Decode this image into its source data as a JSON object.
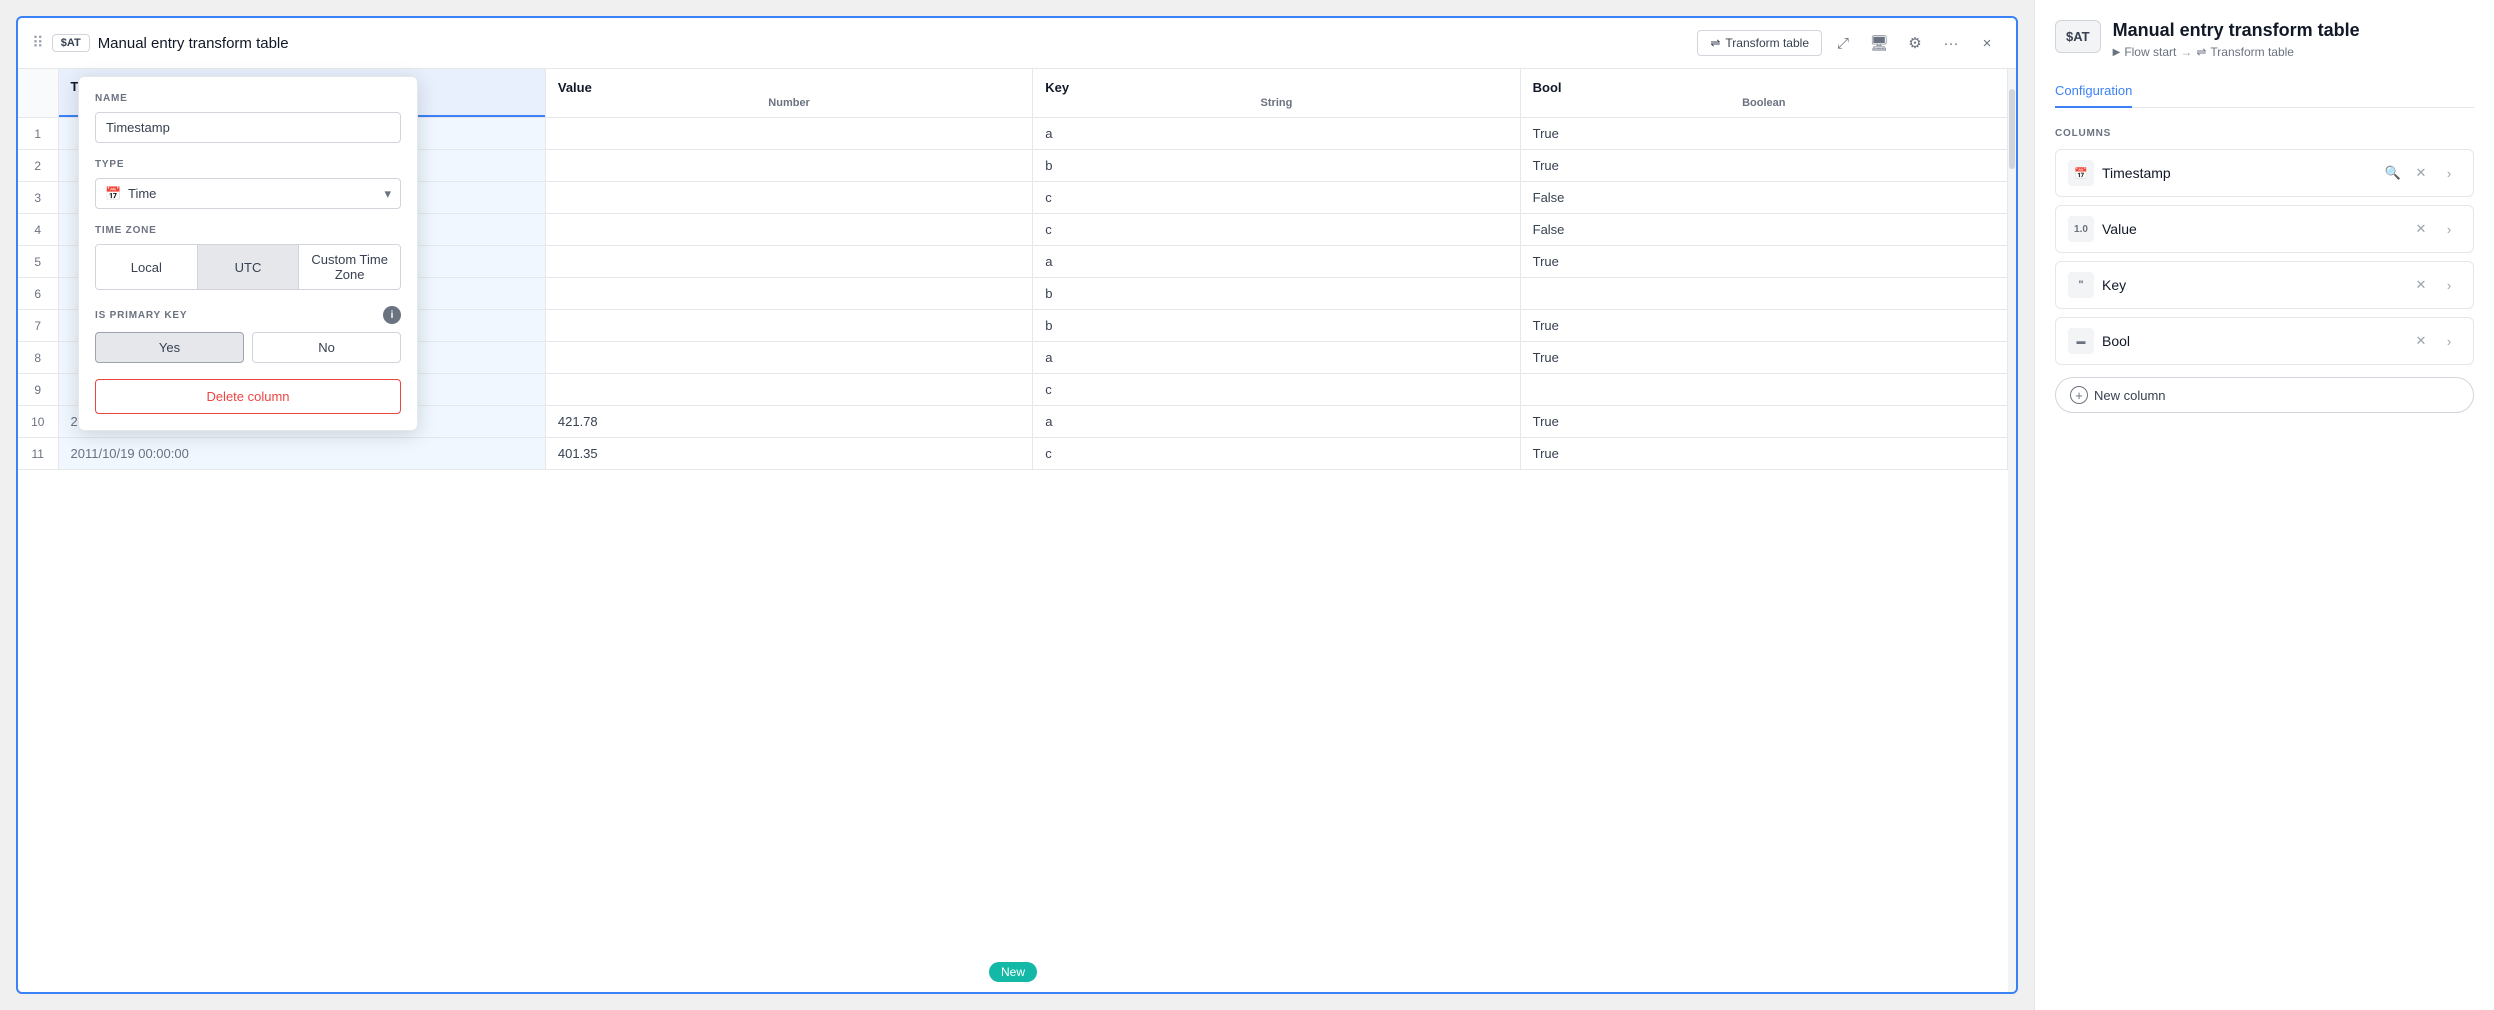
{
  "window": {
    "title": "Manual entry transform table",
    "sat_badge": "$AT",
    "transform_table_btn": "Transform table",
    "close_label": "×"
  },
  "table": {
    "columns": [
      {
        "name": "Timestamp",
        "type": "Time (UTC)",
        "active": true
      },
      {
        "name": "Value",
        "type": "Number",
        "active": false
      },
      {
        "name": "Key",
        "type": "String",
        "active": false
      },
      {
        "name": "Bool",
        "type": "Boolean",
        "active": false
      }
    ],
    "rows": [
      {
        "num": 1,
        "timestamp": "",
        "value": "",
        "key": "a",
        "bool": "True"
      },
      {
        "num": 2,
        "timestamp": "",
        "value": "",
        "key": "b",
        "bool": "True"
      },
      {
        "num": 3,
        "timestamp": "",
        "value": "",
        "key": "c",
        "bool": "False"
      },
      {
        "num": 4,
        "timestamp": "",
        "value": "",
        "key": "c",
        "bool": "False"
      },
      {
        "num": 5,
        "timestamp": "",
        "value": "",
        "key": "a",
        "bool": "True"
      },
      {
        "num": 6,
        "timestamp": "",
        "value": "",
        "key": "b",
        "bool": ""
      },
      {
        "num": 7,
        "timestamp": "",
        "value": "",
        "key": "b",
        "bool": "True"
      },
      {
        "num": 8,
        "timestamp": "",
        "value": "",
        "key": "a",
        "bool": "True"
      },
      {
        "num": 9,
        "timestamp": "",
        "value": "",
        "key": "c",
        "bool": ""
      },
      {
        "num": 10,
        "timestamp": "2011/10/18 00:00:00",
        "value": "421.78",
        "key": "a",
        "bool": "True"
      },
      {
        "num": 11,
        "timestamp": "2011/10/19 00:00:00",
        "value": "401.35",
        "key": "c",
        "bool": "True"
      }
    ],
    "new_badge": "New"
  },
  "popup": {
    "name_label": "NAME",
    "name_value": "Timestamp",
    "type_label": "TYPE",
    "type_value": "Time",
    "type_icon": "📅",
    "timezone_label": "TIME ZONE",
    "timezone_options": [
      "Local",
      "UTC",
      "Custom Time Zone"
    ],
    "timezone_active": "UTC",
    "primary_key_label": "IS PRIMARY KEY",
    "yes_label": "Yes",
    "no_label": "No",
    "primary_active": "Yes",
    "delete_label": "Delete column"
  },
  "sidebar": {
    "sat_badge": "$AT",
    "title": "Manual entry transform table",
    "breadcrumb": {
      "flow_start": "Flow start",
      "separator": "→",
      "transform_table": "Transform table"
    },
    "tab_active": "Configuration",
    "tabs": [
      "Configuration"
    ],
    "columns_label": "COLUMNS",
    "columns": [
      {
        "name": "Timestamp",
        "icon": "📅",
        "icon_type": "calendar"
      },
      {
        "name": "Value",
        "icon": "1.0",
        "icon_type": "number"
      },
      {
        "name": "Key",
        "icon": "❝❞",
        "icon_type": "string"
      },
      {
        "name": "Bool",
        "icon": "▬",
        "icon_type": "bool"
      }
    ],
    "new_column_label": "New column"
  }
}
